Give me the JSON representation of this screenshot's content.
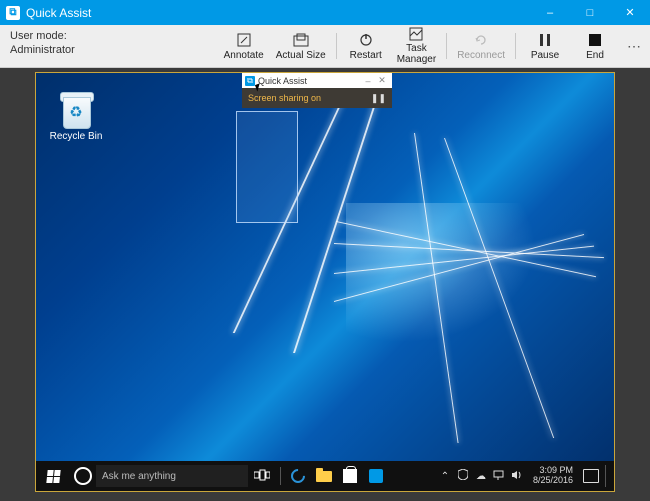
{
  "app": {
    "title": "Quick Assist",
    "user_mode_label": "User mode:",
    "user_mode_value": "Administrator"
  },
  "toolbar": {
    "annotate": "Annotate",
    "actual_size": "Actual Size",
    "restart": "Restart",
    "task_manager": "Task\nManager",
    "reconnect": "Reconnect",
    "pause": "Pause",
    "end": "End"
  },
  "remote": {
    "recycle_bin": "Recycle Bin",
    "mini_title": "Quick Assist",
    "mini_status": "Screen sharing on",
    "search_placeholder": "Ask me anything",
    "time": "3:09 PM",
    "date": "8/25/2016"
  }
}
